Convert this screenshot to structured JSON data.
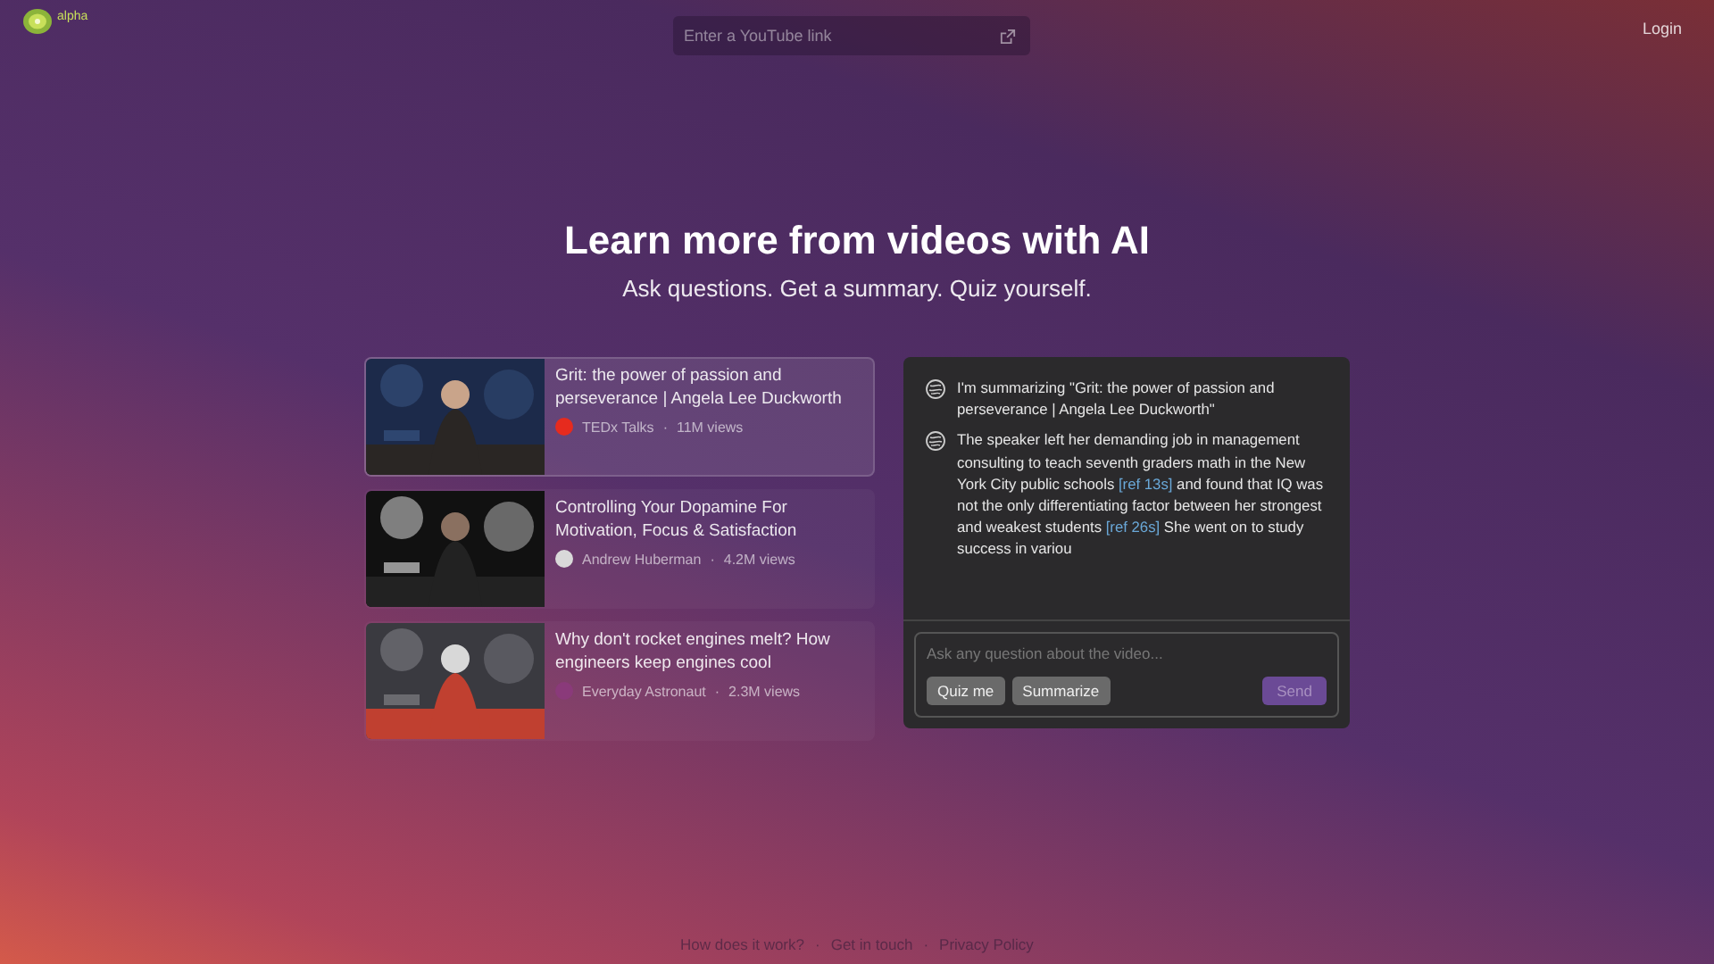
{
  "header": {
    "badge": "alpha",
    "search": {
      "placeholder": "Enter a YouTube link"
    },
    "login": "Login"
  },
  "hero": {
    "title": "Learn more from videos with AI",
    "subtitle": "Ask questions. Get a summary. Quiz yourself."
  },
  "videos": [
    {
      "title": "Grit: the power of passion and perseverance | Angela Lee Duckworth",
      "channel": "TEDx Talks",
      "separator": "·",
      "views": "11M views",
      "selected": true,
      "color": "#e62b1e"
    },
    {
      "title": "Controlling Your Dopamine For Motivation, Focus & Satisfaction",
      "channel": "Andrew Huberman",
      "separator": "·",
      "views": "4.2M views",
      "selected": false,
      "color": "#d9d9d9"
    },
    {
      "title": "Why don't rocket engines melt? How engineers keep engines cool",
      "channel": "Everyday Astronaut",
      "separator": "·",
      "views": "2.3M views",
      "selected": false,
      "color": "#8a3a7a"
    }
  ],
  "chat": {
    "messages": [
      {
        "parts": [
          {
            "kind": "text",
            "text": "I'm summarizing \"Grit: the power of passion and perseverance | Angela Lee Duckworth\""
          }
        ]
      },
      {
        "parts": [
          {
            "kind": "text",
            "text": "The speaker left her demanding job in management consulting to teach seventh graders math in the New York City public schools "
          },
          {
            "kind": "ref",
            "text": "[ref 13s]"
          },
          {
            "kind": "text",
            "text": " and found that IQ was not the only differentiating factor between her strongest and weakest students "
          },
          {
            "kind": "ref",
            "text": "[ref 26s]"
          },
          {
            "kind": "text",
            "text": " She went on to study success in variou"
          }
        ]
      }
    ],
    "input": {
      "placeholder": "Ask any question about the video..."
    },
    "actions": [
      "Quiz me",
      "Summarize"
    ],
    "send": {
      "label": "Send",
      "disabled": true
    }
  },
  "footer": {
    "links": [
      "How does it work?",
      "Get in touch",
      "Privacy Policy"
    ],
    "separators": [
      "·",
      "·"
    ]
  }
}
